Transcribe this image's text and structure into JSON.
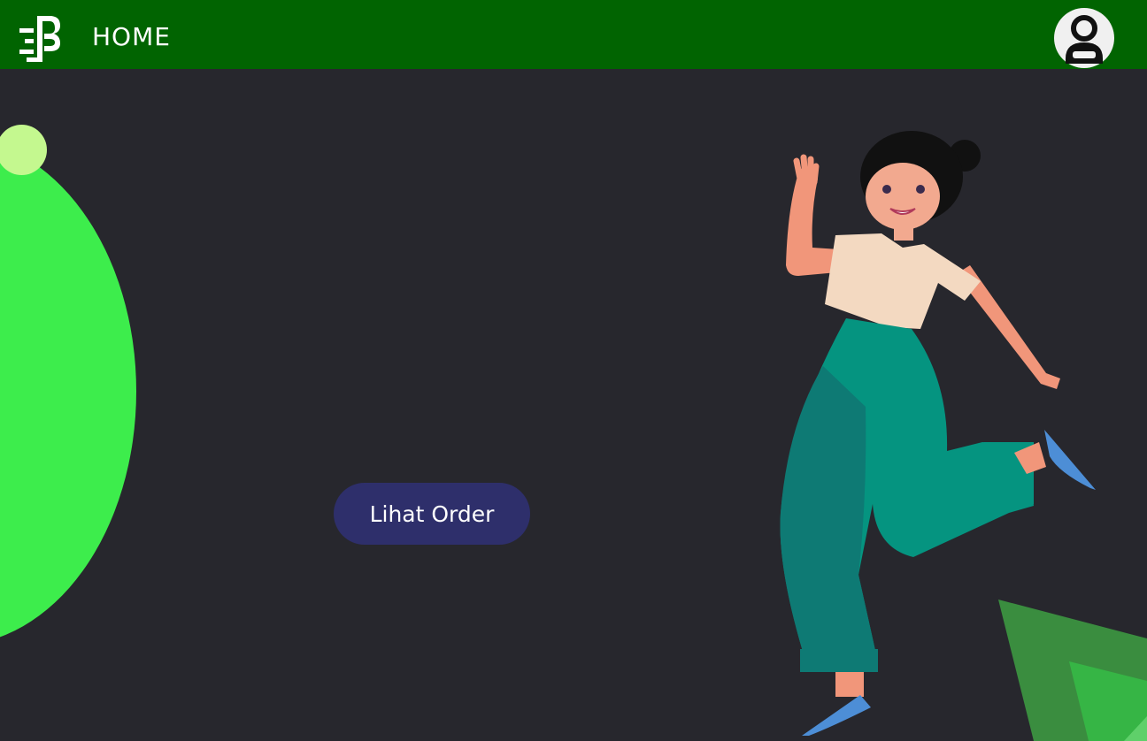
{
  "header": {
    "title": "HOME",
    "logo_icon": "brand-logo-icon",
    "profile_icon": "user-profile-icon",
    "background_color": "#016401"
  },
  "main": {
    "order_button_label": "Lihat Order",
    "button_color": "#2e2f6b",
    "background_color": "#27272d"
  },
  "decorations": {
    "illustration": "waving-jumping-woman-illustration",
    "circle_color": "#3ded4c",
    "small_circle_color": "#c4f88f",
    "triangle_color": "#3a8d3f"
  }
}
